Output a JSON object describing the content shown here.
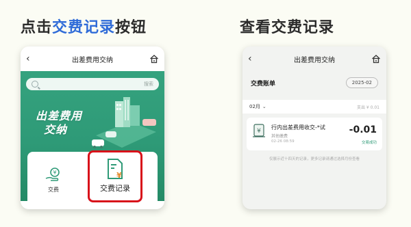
{
  "headings": {
    "left": {
      "prefix": "点击",
      "highlight": "交费记录",
      "suffix": "按钮"
    },
    "right": "查看交费记录"
  },
  "left_phone": {
    "nav": {
      "back": "‹",
      "title": "出差费用交纳",
      "home_icon": "home-icon"
    },
    "search": {
      "placeholder": "搜索"
    },
    "banner": {
      "line1": "出差费用",
      "line2": "交纳"
    },
    "services": [
      {
        "label": "交费",
        "icon": "hand-coin-icon"
      },
      {
        "label": "交费记录",
        "icon": "document-yen-icon"
      }
    ]
  },
  "right_phone": {
    "nav": {
      "back": "‹",
      "title": "出差费用交纳",
      "home_icon": "home-icon"
    },
    "bill": {
      "title": "交费账单",
      "date": "2025-02"
    },
    "month": {
      "label": "02月",
      "stats": "支出 ¥ 0.01"
    },
    "record": {
      "title": "行内出差费用收交-*试",
      "subtitle": "其他缴费",
      "time": "02-26 08:59",
      "amount": "-0.01",
      "status": "交易成功"
    },
    "footnote": "仅展示近十四天的记录，更多记录请通过选择月份查看"
  },
  "colors": {
    "brand_green": "#2e9a77",
    "highlight_blue": "#2f6bd8",
    "callout_red": "#d8101a"
  }
}
